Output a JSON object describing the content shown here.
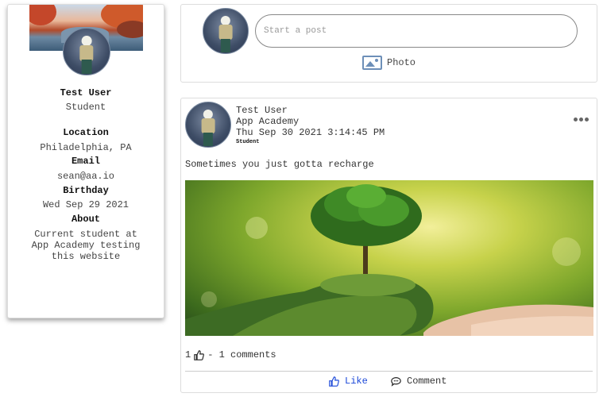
{
  "profile": {
    "name": "Test User",
    "role": "Student",
    "location_label": "Location",
    "location": "Philadelphia, PA",
    "email_label": "Email",
    "email": "sean@aa.io",
    "birthday_label": "Birthday",
    "birthday": "Wed Sep 29 2021",
    "about_label": "About",
    "about_lines": [
      "Current student at",
      "App Academy testing",
      "this website"
    ]
  },
  "create_post": {
    "placeholder": "Start a post",
    "photo_label": "Photo"
  },
  "post": {
    "author": "Test User",
    "org": "App Academy",
    "timestamp": "Thu Sep 30 2021 3:14:45 PM",
    "author_role": "Student",
    "text": "Sometimes you just gotta recharge",
    "likes": "1",
    "comments_text": "- 1 comments",
    "like_label": "Like",
    "comment_label": "Comment"
  },
  "icons": {
    "photo": "image-icon",
    "more": "ellipsis-icon",
    "like": "thumbs-up-icon",
    "comment": "speech-bubble-icon"
  },
  "colors": {
    "accent": "#1a47d8",
    "photo_icon": "#6d8fb8"
  }
}
